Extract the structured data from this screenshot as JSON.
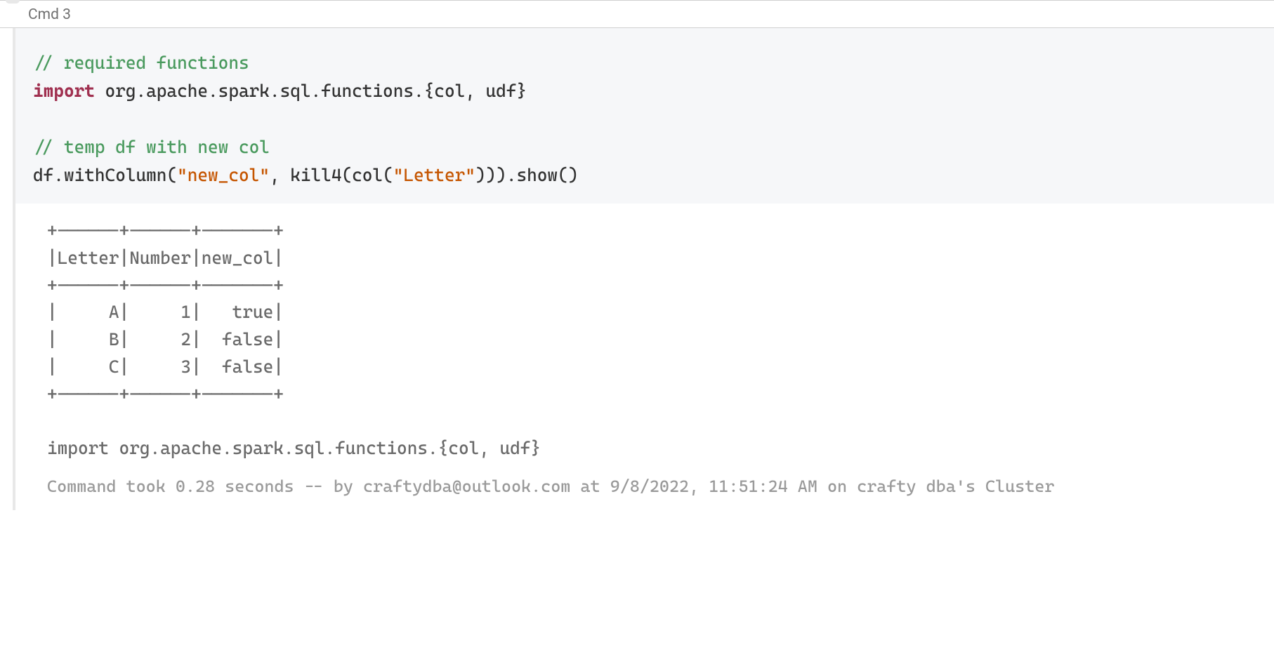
{
  "cell": {
    "label": "Cmd 3"
  },
  "code": {
    "comment1": "// required functions",
    "import_kw": "import",
    "import_rest": " org.apache.spark.sql.functions.{col, udf}",
    "comment2": "// temp df with new col",
    "line2_a": "df.withColumn(",
    "line2_str1": "\"new_col\"",
    "line2_b": ", kill4(col(",
    "line2_str2": "\"Letter\"",
    "line2_c": "))).show()"
  },
  "output": {
    "sep": "+------+------+-------+",
    "header": "|Letter|Number|new_col|",
    "row1": "|     A|     1|   true|",
    "row2": "|     B|     2|  false|",
    "row3": "|     C|     3|  false|",
    "import_echo": "import org.apache.spark.sql.functions.{col, udf}"
  },
  "meta": {
    "text": "Command took 0.28 seconds -- by craftydba@outlook.com at 9/8/2022, 11:51:24 AM on crafty dba's Cluster"
  },
  "chart_data": {
    "type": "table",
    "columns": [
      "Letter",
      "Number",
      "new_col"
    ],
    "rows": [
      {
        "Letter": "A",
        "Number": 1,
        "new_col": true
      },
      {
        "Letter": "B",
        "Number": 2,
        "new_col": false
      },
      {
        "Letter": "C",
        "Number": 3,
        "new_col": false
      }
    ]
  }
}
